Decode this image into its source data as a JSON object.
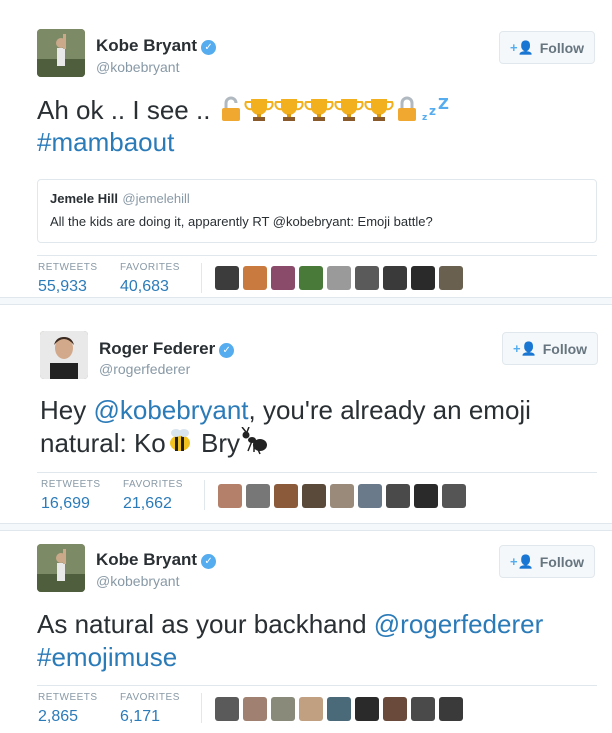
{
  "tweets": [
    {
      "name": "Kobe Bryant",
      "handle": "@kobebryant",
      "follow_label": "Follow",
      "text_line1": "Ah ok .. I see ..",
      "hashtag": "#mambaout",
      "emoji_sequence": [
        "unlock-icon",
        "trophy-icon",
        "trophy-icon",
        "trophy-icon",
        "trophy-icon",
        "trophy-icon",
        "lock-icon",
        "zzz-icon"
      ],
      "quote": {
        "name": "Jemele Hill",
        "handle": "@jemelehill",
        "text": "All the kids are doing it, apparently RT @kobebryant: Emoji battle?"
      },
      "retweets_label": "RETWEETS",
      "retweets": "55,933",
      "favorites_label": "FAVORITES",
      "favorites": "40,683"
    },
    {
      "name": "Roger Federer",
      "handle": "@rogerfederer",
      "follow_label": "Follow",
      "text_line1_pre": "Hey ",
      "mention": "@kobebryant",
      "text_line1_post": ", you're already an emoji",
      "text_line2_pre": "natural: Ko",
      "text_line2_mid": " Bry",
      "emoji_sequence": [
        "bee-icon",
        "ant-icon"
      ],
      "retweets_label": "RETWEETS",
      "retweets": "16,699",
      "favorites_label": "FAVORITES",
      "favorites": "21,662"
    },
    {
      "name": "Kobe Bryant",
      "handle": "@kobebryant",
      "follow_label": "Follow",
      "text_line1_pre": "As natural as your backhand ",
      "mention": "@rogerfederer",
      "hashtag": "#emojimuse",
      "retweets_label": "RETWEETS",
      "retweets": "2,865",
      "favorites_label": "FAVORITES",
      "favorites": "6,171"
    }
  ],
  "colors": {
    "link": "#2b7bb9",
    "verified": "#55acee",
    "trophy": "#f2b01e",
    "lock": "#f0a830"
  }
}
